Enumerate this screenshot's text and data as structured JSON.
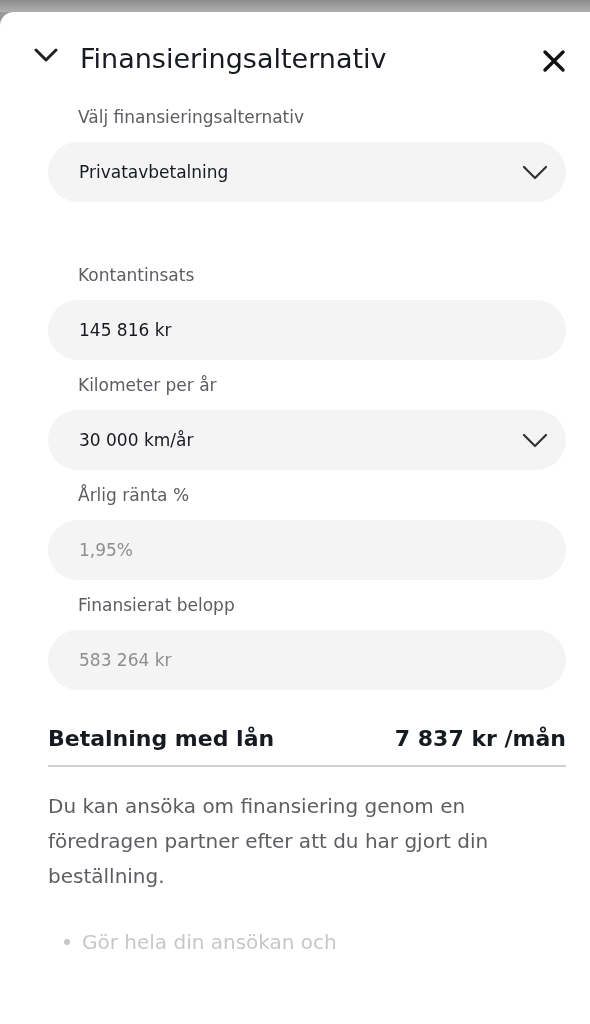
{
  "panel": {
    "title": "Finansieringsalternativ",
    "expanded": true
  },
  "fields": [
    {
      "label": "Välj finansieringsalternativ",
      "value": "Privatavbetalning",
      "kind": "dropdown",
      "disabled": false
    },
    {
      "label": "Kontantinsats",
      "value": "145 816 kr",
      "kind": "input",
      "disabled": false
    },
    {
      "label": "Kilometer per år",
      "value": "30 000 km/år",
      "kind": "dropdown",
      "disabled": false
    },
    {
      "label": "Årlig ränta %",
      "value": "1,95%",
      "kind": "input",
      "disabled": true
    },
    {
      "label": "Finansierat belopp",
      "value": "583 264 kr",
      "kind": "input",
      "disabled": true
    }
  ],
  "summary": {
    "label": "Betalning med lån",
    "amount": "7 837 kr /mån"
  },
  "description": "Du kan ansöka om finansiering genom en föredragen partner efter att du har gjort din beställning.",
  "bullets": [
    "Gör hela din ansökan och"
  ]
}
